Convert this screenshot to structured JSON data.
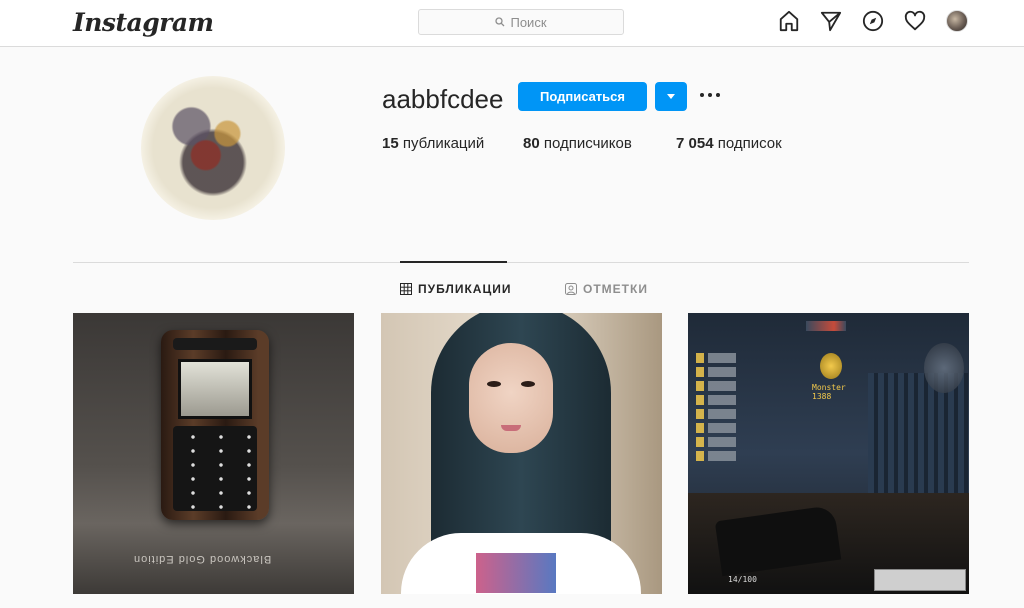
{
  "nav": {
    "logo": "Instagram",
    "search_placeholder": "Поиск",
    "icons": [
      "home-icon",
      "direct-icon",
      "explore-icon",
      "activity-heart-icon",
      "profile-avatar"
    ]
  },
  "profile": {
    "username": "aabbfcdee",
    "follow_label": "Подписаться",
    "stats": {
      "posts_count": "15",
      "posts_label": "публикаций",
      "followers_count": "80",
      "followers_label": "подписчиков",
      "following_count": "7 054",
      "following_label": "подписок"
    }
  },
  "tabs": [
    {
      "label": "ПУБЛИКАЦИИ",
      "active": true,
      "icon": "grid-icon"
    },
    {
      "label": "ОТМЕТКИ",
      "active": false,
      "icon": "tagged-icon"
    }
  ],
  "posts": [
    {
      "caption_text": "Blackwood Gold Edition",
      "subject": "mobile phone"
    },
    {
      "subject": "girl selfie"
    },
    {
      "subject": "game screenshot",
      "hud_text": "Monster",
      "hud_number": "1388",
      "ammo": "14/100"
    }
  ],
  "colors": {
    "accent": "#0095f6",
    "border": "#dbdbdb",
    "text": "#262626",
    "muted": "#8e8e8e"
  }
}
